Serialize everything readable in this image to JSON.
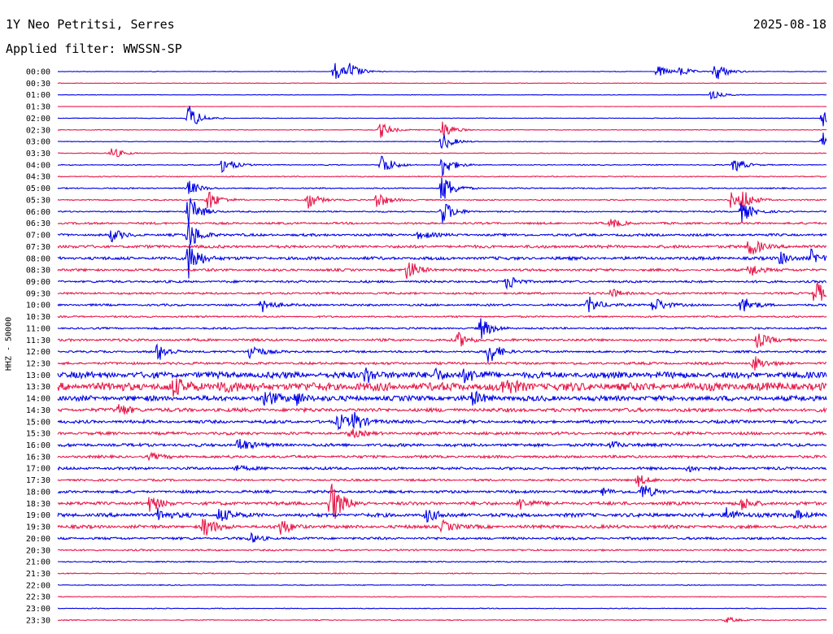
{
  "header": {
    "station": "1Y Neo Petritsi, Serres",
    "date": "2025-08-18",
    "filter": "Applied filter: WWSSN-SP"
  },
  "chart_data": {
    "type": "line",
    "title": "1Y Neo Petritsi, Serres",
    "date": "2025-08-18",
    "filter": "WWSSN-SP",
    "ylabel": "HHZ - 50000",
    "xlabel": "",
    "trace_colors": [
      "#0000e6",
      "#e6194b"
    ],
    "row_interval_minutes": 30,
    "y_ticks": [
      "00:00",
      "00:30",
      "01:00",
      "01:30",
      "02:00",
      "02:30",
      "03:00",
      "03:30",
      "04:00",
      "04:30",
      "05:00",
      "05:30",
      "06:00",
      "06:30",
      "07:00",
      "07:30",
      "08:00",
      "08:30",
      "09:00",
      "09:30",
      "10:00",
      "10:30",
      "11:00",
      "11:30",
      "12:00",
      "12:30",
      "13:00",
      "13:30",
      "14:00",
      "14:30",
      "15:00",
      "15:30",
      "16:00",
      "16:30",
      "17:00",
      "17:30",
      "18:00",
      "18:30",
      "19:00",
      "19:30",
      "20:00",
      "20:30",
      "21:00",
      "21:30",
      "22:00",
      "22:30",
      "23:00",
      "23:30"
    ],
    "noise_levels": [
      0.3,
      0.25,
      0.2,
      0.15,
      0.3,
      0.35,
      0.3,
      0.4,
      0.45,
      0.5,
      0.6,
      0.6,
      0.7,
      1.0,
      1.2,
      1.4,
      1.5,
      1.2,
      1.1,
      1.0,
      1.0,
      0.8,
      0.9,
      1.2,
      1.0,
      1.2,
      3.0,
      4.0,
      2.5,
      1.8,
      1.5,
      1.4,
      1.5,
      1.3,
      1.3,
      1.0,
      1.3,
      1.6,
      1.8,
      1.6,
      1.2,
      0.8,
      0.6,
      0.5,
      0.4,
      0.35,
      0.35,
      0.45
    ],
    "events": [
      [
        [
          0.36,
          12
        ],
        [
          0.38,
          10
        ],
        [
          0.78,
          8
        ],
        [
          0.81,
          6
        ],
        [
          0.855,
          14
        ]
      ],
      [],
      [
        [
          0.85,
          6
        ]
      ],
      [],
      [
        [
          0.17,
          18
        ],
        [
          0.995,
          12
        ]
      ],
      [
        [
          0.42,
          10
        ],
        [
          0.5,
          12
        ]
      ],
      [
        [
          0.5,
          12
        ],
        [
          0.995,
          14
        ]
      ],
      [
        [
          0.07,
          8
        ]
      ],
      [
        [
          0.215,
          12
        ],
        [
          0.42,
          16
        ],
        [
          0.5,
          15
        ],
        [
          0.88,
          10
        ]
      ],
      [],
      [
        [
          0.5,
          20
        ],
        [
          0.17,
          10
        ]
      ],
      [
        [
          0.195,
          14
        ],
        [
          0.325,
          12
        ],
        [
          0.415,
          12
        ],
        [
          0.875,
          10
        ],
        [
          0.89,
          12
        ]
      ],
      [
        [
          0.17,
          22
        ],
        [
          0.5,
          16
        ],
        [
          0.89,
          14
        ]
      ],
      [
        [
          0.72,
          6
        ]
      ],
      [
        [
          0.17,
          20
        ],
        [
          0.07,
          8
        ],
        [
          0.47,
          6
        ]
      ],
      [
        [
          0.9,
          14
        ]
      ],
      [
        [
          0.17,
          25
        ],
        [
          0.94,
          8
        ],
        [
          0.98,
          10
        ]
      ],
      [
        [
          0.455,
          14
        ],
        [
          0.9,
          10
        ]
      ],
      [
        [
          0.585,
          10
        ]
      ],
      [
        [
          0.72,
          6
        ],
        [
          0.985,
          18
        ]
      ],
      [
        [
          0.265,
          10
        ],
        [
          0.69,
          12
        ],
        [
          0.775,
          12
        ],
        [
          0.89,
          12
        ]
      ],
      [],
      [
        [
          0.55,
          14
        ]
      ],
      [
        [
          0.52,
          10
        ],
        [
          0.91,
          10
        ]
      ],
      [
        [
          0.13,
          12
        ],
        [
          0.25,
          12
        ],
        [
          0.56,
          16
        ]
      ],
      [
        [
          0.905,
          10
        ]
      ],
      [
        [
          0.4,
          10
        ],
        [
          0.49,
          8
        ],
        [
          0.53,
          8
        ]
      ],
      [
        [
          0.15,
          10
        ],
        [
          0.21,
          8
        ],
        [
          0.58,
          10
        ]
      ],
      [
        [
          0.27,
          10
        ],
        [
          0.31,
          8
        ],
        [
          0.54,
          8
        ]
      ],
      [
        [
          0.08,
          8
        ]
      ],
      [
        [
          0.365,
          10
        ],
        [
          0.385,
          12
        ]
      ],
      [
        [
          0.38,
          6
        ]
      ],
      [
        [
          0.235,
          10
        ],
        [
          0.72,
          5
        ]
      ],
      [
        [
          0.12,
          4
        ]
      ],
      [
        [
          0.23,
          4
        ],
        [
          0.82,
          5
        ]
      ],
      [
        [
          0.755,
          8
        ]
      ],
      [
        [
          0.76,
          10
        ],
        [
          0.71,
          5
        ]
      ],
      [
        [
          0.12,
          10
        ],
        [
          0.355,
          30
        ],
        [
          0.6,
          8
        ],
        [
          0.89,
          8
        ]
      ],
      [
        [
          0.13,
          8
        ],
        [
          0.21,
          10
        ],
        [
          0.48,
          8
        ],
        [
          0.87,
          10
        ],
        [
          0.96,
          6
        ]
      ],
      [
        [
          0.19,
          14
        ],
        [
          0.29,
          10
        ],
        [
          0.5,
          8
        ]
      ],
      [
        [
          0.25,
          6
        ]
      ],
      [],
      [],
      [],
      [],
      [],
      [],
      [
        [
          0.87,
          4
        ]
      ]
    ]
  }
}
